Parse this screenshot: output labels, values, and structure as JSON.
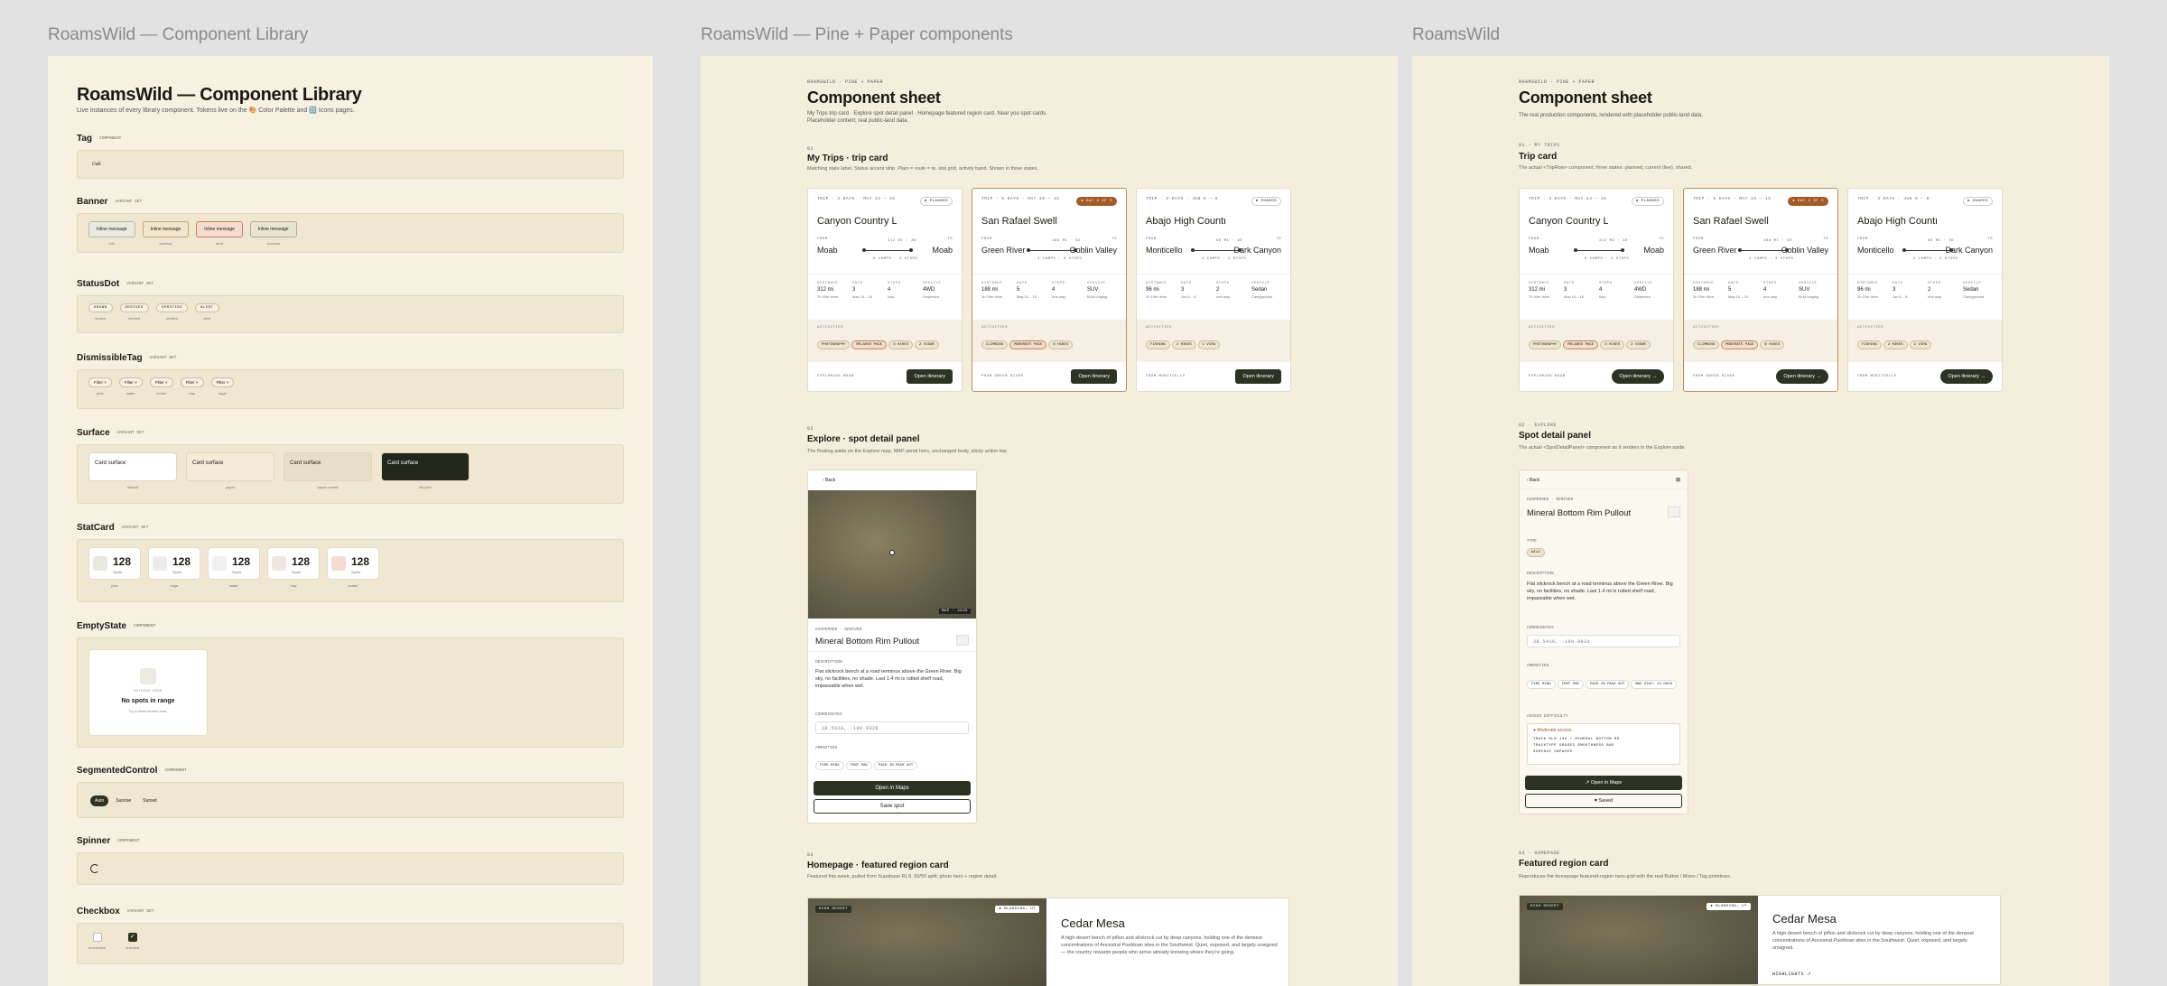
{
  "frames": {
    "b1_title": "RoamsWild — Component Library",
    "b2_title": "RoamsWild — Pine + Paper components",
    "b3_title": "RoamsWild"
  },
  "library": {
    "title": "RoamsWild — Component Library",
    "subtitle": "Live instances of every library component. Tokens live on the 🎨 Color Palette and 🔠 Icons pages.",
    "sections": {
      "tag": {
        "name": "Tag",
        "kind": "COMPONENT",
        "sample": "cwe"
      },
      "banner": {
        "name": "Banner",
        "kind": "VARIANT SET",
        "items": [
          {
            "label": "Inline message",
            "cap": "info",
            "bg": "#e9eadf",
            "border": "#b9bca8"
          },
          {
            "label": "Inline message",
            "cap": "warning",
            "bg": "#f3e5cc",
            "border": "#c9a46a"
          },
          {
            "label": "Inline message",
            "cap": "error",
            "bg": "#f3dccf",
            "border": "#c98260"
          },
          {
            "label": "Inline message",
            "cap": "success",
            "bg": "#e9e4d0",
            "border": "#b7ac88"
          }
        ]
      },
      "statusdot": {
        "name": "StatusDot",
        "kind": "VARIANT SET",
        "items": [
          {
            "label": "KNOWN",
            "cap": "known"
          },
          {
            "label": "DERIVED",
            "cap": "derived"
          },
          {
            "label": "VERIFIED",
            "cap": "verified"
          },
          {
            "label": "ALERT",
            "cap": "alert"
          }
        ]
      },
      "dismissible": {
        "name": "DismissibleTag",
        "kind": "VARIANT SET",
        "items": [
          {
            "label": "Filter ×",
            "cap": "pine"
          },
          {
            "label": "Filter ×",
            "cap": "water"
          },
          {
            "label": "Filter ×",
            "cap": "ember"
          },
          {
            "label": "Filter ×",
            "cap": "clay"
          },
          {
            "label": "Filter ×",
            "cap": "sage"
          }
        ]
      },
      "surface": {
        "name": "Surface",
        "kind": "VARIANT SET",
        "items": [
          {
            "label": "Card surface",
            "cap": "default",
            "bg": "#ffffff",
            "fg": "#1a1a14"
          },
          {
            "label": "Card surface",
            "cap": "paper",
            "bg": "#f3ecd8",
            "fg": "#1a1a14"
          },
          {
            "label": "Card surface",
            "cap": "paper-muted",
            "bg": "#e6dfc8",
            "fg": "#1a1a14"
          },
          {
            "label": "Card surface",
            "cap": "ink-pine",
            "bg": "#22261b",
            "fg": "#ffffff"
          }
        ]
      },
      "statcard": {
        "name": "StatCard",
        "kind": "VARIANT SET",
        "items": [
          {
            "value": "128",
            "label": "Spots",
            "cap": "pine",
            "tint": "#e7e8e0"
          },
          {
            "value": "128",
            "label": "Spots",
            "cap": "sage",
            "tint": "#ececec"
          },
          {
            "value": "128",
            "label": "Spots",
            "cap": "water",
            "tint": "#f0f0f0"
          },
          {
            "value": "128",
            "label": "Spots",
            "cap": "clay",
            "tint": "#efe6de"
          },
          {
            "value": "128",
            "label": "Spots",
            "cap": "ember",
            "tint": "#f5dcd3"
          }
        ]
      },
      "empty": {
        "name": "EmptyState",
        "kind": "COMPONENT",
        "eyebrow": "NOTHING HERE",
        "title": "No spots in range",
        "sub": "Try a wider search area."
      },
      "segmented": {
        "name": "SegmentedControl",
        "kind": "COMPONENT",
        "options": [
          "Auto",
          "Sunrise",
          "Sunset"
        ]
      },
      "spinner": {
        "name": "Spinner",
        "kind": "COMPONENT"
      },
      "checkbox": {
        "name": "Checkbox",
        "kind": "VARIANT SET",
        "items": [
          {
            "cap": "unchecked"
          },
          {
            "cap": "checked"
          }
        ]
      }
    }
  },
  "sheet_a": {
    "eyebrow": "ROAMSWILD · PINE + PAPER",
    "title": "Component sheet",
    "subtitle1": "My Trips trip card · Explore spot detail panel · Homepage featured region card. Near you spot cards.",
    "subtitle2": "Placeholder content; real public-land data.",
    "s1_num": "01",
    "s1_title": "My Trips · trip card",
    "s1_desc": "Matching state label. Status accent strip. Plain = route = to. stat grid, activity band. Shown in three states.",
    "s2_num": "02",
    "s2_title": "Explore · spot detail panel",
    "s2_desc": "The floating aside on the Explore map. MAP aerial hero, unchanged body, sticky action bar.",
    "s3_num": "03",
    "s3_title": "Homepage · featured region card",
    "s3_desc": "Featured this week; pulled from Supabase RLS. 50/50 split: photo hero + region detail."
  },
  "sheet_b": {
    "eyebrow": "ROAMSWILD · PINE + PAPER",
    "title": "Component sheet",
    "subtitle": "The real production components, rendered with placeholder public-land data.",
    "s1_num": "01 · MY TRIPS",
    "s1_title": "Trip card",
    "s1_desc": "The actual <TripRow> component, three states: planned, current (live), shared.",
    "s2_num": "02 · EXPLORE",
    "s2_title": "Spot detail panel",
    "s2_desc": "The actual <SpotDetailPanel> component as it renders in the Explore aside.",
    "s3_num": "03 · HOMEPAGE",
    "s3_title": "Featured region card",
    "s3_desc": "Reproduces the homepage featured-region hero-grid with the real Button / Mono / Tag primitives."
  },
  "trips": [
    {
      "meta": "TRIP · 3 DAYS · MAY 14 — 16",
      "badge": "● PLANNED",
      "badge_type": "plain",
      "title": "Canyon Country Loop",
      "from": "Moab",
      "to": "Moab",
      "mid": "312 MI · 3D",
      "stops_line": "6 CAMPS · 3 STOPS",
      "stats": [
        {
          "k": "DISTANCE",
          "v": "312 mi",
          "s": "7h 40m drive"
        },
        {
          "k": "DAYS",
          "v": "3",
          "s": "May 14 – 16"
        },
        {
          "k": "STOPS",
          "v": "4",
          "s": "loop"
        },
        {
          "k": "VEHICLE",
          "v": "4WD",
          "s": "Dispersed"
        }
      ],
      "chips": [
        "PHOTOGRAPHY",
        "RELAXED PACE",
        "3 HIKES",
        "2 VIEWS"
      ],
      "orange_chips": [
        1
      ],
      "foot": "EXPLORING MOAB",
      "button": "Open itinerary"
    },
    {
      "meta": "TRIP · 5 DAYS · MAY 10 — 15",
      "badge": "● DAY 2 OF 5",
      "badge_type": "orange",
      "title": "San Rafael Swell",
      "from": "Green River",
      "to": "Goblin Valley",
      "mid": "188 MI · 5D",
      "stops_line": "4 CAMPS · 3 STOPS",
      "stats": [
        {
          "k": "DISTANCE",
          "v": "188 mi",
          "s": "3h 20m drive"
        },
        {
          "k": "DAYS",
          "v": "5",
          "s": "May 10 – 15"
        },
        {
          "k": "STOPS",
          "v": "4",
          "s": "one-way"
        },
        {
          "k": "VEHICLE",
          "v": "SUV",
          "s": "BLM lodging"
        }
      ],
      "chips": [
        "CLIMBING",
        "MODERATE PACE",
        "6 HIKES"
      ],
      "orange_chips": [
        1
      ],
      "foot": "FROM GREEN RIVER",
      "button": "Open itinerary"
    },
    {
      "meta": "TRIP · 3 DAYS · JUN 6 — 8",
      "badge": "● SHARED",
      "badge_type": "plain",
      "title": "Abajo High Country",
      "from": "Monticello",
      "to": "Dark Canyon",
      "mid": "96 MI · 3D",
      "stops_line": "2 CAMPS · 2 STOPS",
      "stats": [
        {
          "k": "DISTANCE",
          "v": "96 mi",
          "s": "2h 10m drive"
        },
        {
          "k": "DAYS",
          "v": "3",
          "s": "Jun 6 – 8"
        },
        {
          "k": "STOPS",
          "v": "2",
          "s": "one-way"
        },
        {
          "k": "VEHICLE",
          "v": "Sedan",
          "s": "Campground"
        }
      ],
      "chips": [
        "FISHING",
        "2 HIKES",
        "1 VIEW"
      ],
      "orange_chips": [],
      "foot": "FROM MONTICELLO",
      "button": "Open itinerary"
    }
  ],
  "trips_b_buttons": "Open itinerary →",
  "spot": {
    "back": "‹ Back",
    "eyebrow": "DISPERSED · DERIVED",
    "name": "Mineral Bottom Rim Pullout",
    "map_tag": "MAP · 2025",
    "type_label": "TYPE",
    "type_value": "WILD",
    "desc_label": "DESCRIPTION",
    "desc": "Flat slickrock bench at a road terminus above the Green River. Big sky, no facilities, no shade. Last 1.4 mi is rutted shelf road, impassable when wet.",
    "coord_label": "COORDINATES",
    "coords_a": "38.5020, -109.9320",
    "coords_b": "38.5410, -109.9033",
    "amen_label": "AMENITIES",
    "amenities": [
      "FIRE RING",
      "TENT PAD",
      "PACK IN PACK OUT"
    ],
    "amenities_b": [
      "FIRE RING",
      "TENT PAD",
      "PACK IN PACK OUT",
      "MAX STAY: 14 DAYS"
    ],
    "access_label": "ACCESS DIFFICULTY",
    "access_level": "● Moderate access",
    "access_lines": [
      "TRACK  DLR 135 / MINERAL BOTTOM RD",
      "TRACKTYPE  GRADE3  SMOOTHNESS  BAD",
      "SURFACE  UNPAVED"
    ],
    "open_maps": "Open in Maps",
    "open_maps_b": "↗ Open in Maps",
    "save": "Save spot",
    "saved": "♥ Saved"
  },
  "region": {
    "tag": "HIGH DESERT",
    "count": "● BLANDING, UT",
    "title": "Cedar Mesa",
    "desc": "A high-desert bench of piñon and slickrock cut by deep canyons, holding one of the densest concentrations of Ancestral Puebloan sites in the Southwest. Quiet, exposed, and largely unsigned — the country rewards people who arrive already knowing where they're going.",
    "desc_b": "A high-desert bench of piñon and slickrock cut by deep canyons, holding one of the densest concentrations of Ancestral Puebloan sites in the Southwest. Quiet, exposed, and largely unsigned.",
    "highlights": "HIGHLIGHTS ↗"
  }
}
